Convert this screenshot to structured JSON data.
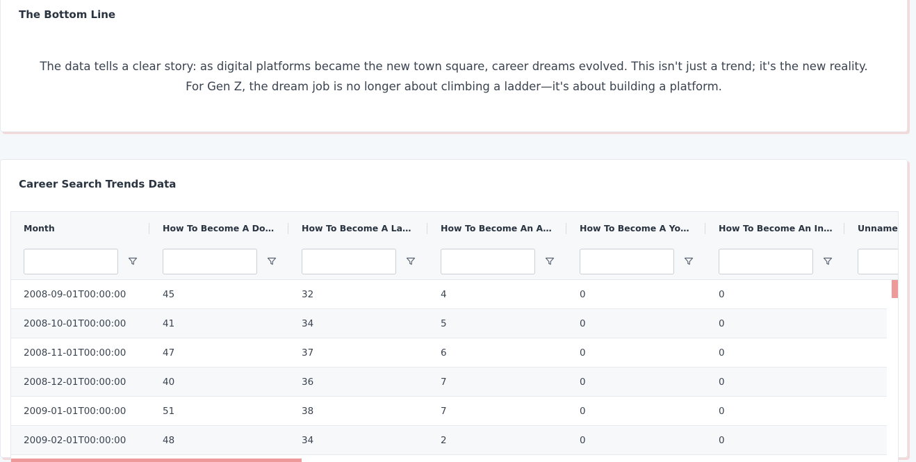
{
  "bottom_line": {
    "title": "The Bottom Line",
    "text_line1": "The data tells a clear story: as digital platforms became the new town square, career dreams evolved. This isn't just a trend; it's the new reality.",
    "text_line2": "For Gen Z, the dream job is no longer about climbing a ladder—it's about building a platform."
  },
  "data_card": {
    "title": "Career Search Trends Data"
  },
  "table": {
    "columns": [
      "Month",
      "How To Become A Doct…",
      "How To Become A Lawy…",
      "How To Become An Astr…",
      "How To Become A Yout…",
      "How To Become An Infl…",
      "Unnamed"
    ],
    "filter_values": [
      "",
      "",
      "",
      "",
      "",
      "",
      ""
    ],
    "rows": [
      [
        "2008-09-01T00:00:00",
        "45",
        "32",
        "4",
        "0",
        "0"
      ],
      [
        "2008-10-01T00:00:00",
        "41",
        "34",
        "5",
        "0",
        "0"
      ],
      [
        "2008-11-01T00:00:00",
        "47",
        "37",
        "6",
        "0",
        "0"
      ],
      [
        "2008-12-01T00:00:00",
        "40",
        "36",
        "7",
        "0",
        "0"
      ],
      [
        "2009-01-01T00:00:00",
        "51",
        "38",
        "7",
        "0",
        "0"
      ],
      [
        "2009-02-01T00:00:00",
        "48",
        "34",
        "2",
        "0",
        "0"
      ]
    ]
  },
  "icons": {
    "filter": "filter-icon"
  },
  "colors": {
    "accent": "#ef9a9a",
    "card_shadow": "#f3dada"
  }
}
